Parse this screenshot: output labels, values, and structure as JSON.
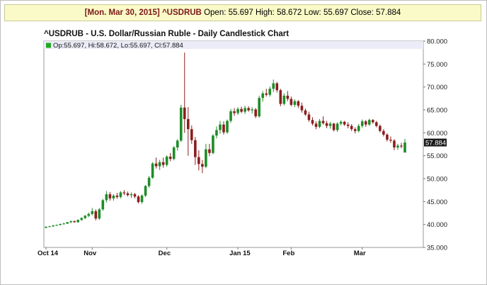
{
  "header": {
    "date": "[Mon. Mar 30, 2015]",
    "symbol": "^USDRUB",
    "open_label": "Open:",
    "open": "55.697",
    "high_label": "High:",
    "high": "58.672",
    "low_label": "Low:",
    "low": "55.697",
    "close_label": "Close:",
    "close": "57.884"
  },
  "colors": {
    "up": "#1e8c28",
    "down": "#8b1e1e",
    "legend_up": "#22aa22",
    "legend_bg": "#ececf8",
    "last_bg": "#1a1a1a"
  },
  "chart_data": {
    "type": "candlestick",
    "title": "^USDRUB - U.S. Dollar/Russian Ruble - Daily Candlestick Chart",
    "legend": "Op:55.697, Hi:58.672, Lo:55.697, Cl:57.884",
    "legend_placement": "top-left",
    "last_value_label": "57.884",
    "ylim": [
      35,
      80
    ],
    "y_ticks": [
      "80.000",
      "75.000",
      "70.000",
      "65.000",
      "60.000",
      "55.000",
      "50.000",
      "45.000",
      "40.000",
      "35.000"
    ],
    "x_labels": [
      {
        "label": "Oct 14",
        "index": 0
      },
      {
        "label": "Nov",
        "index": 13
      },
      {
        "label": "Dec",
        "index": 34
      },
      {
        "label": "Jan 15",
        "index": 54
      },
      {
        "label": "Feb",
        "index": 69
      },
      {
        "label": "Mar",
        "index": 89
      }
    ],
    "grid": false,
    "candles": [
      [
        39.3,
        39.6,
        39.2,
        39.5
      ],
      [
        39.5,
        39.7,
        39.4,
        39.6
      ],
      [
        39.6,
        39.9,
        39.5,
        39.8
      ],
      [
        39.8,
        40.0,
        39.7,
        39.9
      ],
      [
        39.9,
        40.2,
        39.8,
        40.1
      ],
      [
        40.1,
        40.4,
        40.0,
        40.2
      ],
      [
        40.2,
        40.6,
        40.1,
        40.5
      ],
      [
        40.5,
        40.9,
        40.3,
        40.7
      ],
      [
        40.7,
        40.9,
        40.4,
        40.5
      ],
      [
        40.5,
        41.1,
        40.4,
        41.0
      ],
      [
        41.0,
        41.6,
        40.8,
        41.4
      ],
      [
        41.4,
        42.1,
        41.2,
        41.9
      ],
      [
        41.9,
        42.6,
        41.6,
        42.3
      ],
      [
        42.3,
        43.6,
        42.0,
        42.9
      ],
      [
        42.9,
        43.3,
        40.9,
        41.3
      ],
      [
        41.3,
        43.6,
        41.0,
        43.3
      ],
      [
        43.3,
        45.6,
        43.0,
        45.3
      ],
      [
        45.3,
        47.3,
        44.8,
        46.6
      ],
      [
        46.6,
        47.1,
        45.2,
        45.7
      ],
      [
        45.7,
        46.6,
        45.2,
        46.3
      ],
      [
        46.3,
        46.9,
        45.6,
        46.0
      ],
      [
        46.0,
        47.3,
        45.7,
        47.0
      ],
      [
        47.0,
        47.5,
        46.4,
        46.8
      ],
      [
        46.8,
        47.2,
        46.1,
        46.4
      ],
      [
        46.4,
        47.0,
        45.8,
        46.6
      ],
      [
        46.6,
        46.9,
        45.7,
        46.1
      ],
      [
        46.1,
        46.4,
        44.6,
        44.9
      ],
      [
        44.9,
        46.6,
        44.5,
        46.3
      ],
      [
        46.3,
        48.6,
        46.0,
        48.4
      ],
      [
        48.4,
        50.6,
        48.0,
        50.2
      ],
      [
        50.2,
        53.6,
        50.0,
        53.3
      ],
      [
        53.3,
        54.6,
        52.2,
        52.7
      ],
      [
        52.7,
        54.1,
        51.9,
        53.6
      ],
      [
        53.6,
        54.6,
        52.4,
        53.0
      ],
      [
        53.0,
        55.1,
        52.6,
        54.8
      ],
      [
        54.8,
        55.6,
        53.8,
        54.3
      ],
      [
        54.3,
        57.1,
        54.0,
        56.8
      ],
      [
        56.8,
        58.6,
        56.1,
        58.3
      ],
      [
        58.3,
        66.1,
        58.0,
        65.5
      ],
      [
        65.5,
        77.5,
        60.0,
        63.0
      ],
      [
        63.0,
        65.6,
        55.0,
        60.8
      ],
      [
        60.8,
        61.6,
        57.6,
        58.4
      ],
      [
        58.4,
        59.1,
        53.0,
        54.7
      ],
      [
        54.7,
        56.2,
        51.8,
        53.2
      ],
      [
        53.2,
        54.1,
        51.2,
        52.6
      ],
      [
        52.6,
        57.6,
        52.3,
        56.4
      ],
      [
        56.4,
        57.6,
        54.9,
        55.6
      ],
      [
        55.6,
        59.7,
        55.3,
        59.4
      ],
      [
        59.4,
        61.4,
        58.8,
        60.6
      ],
      [
        60.6,
        62.6,
        59.8,
        61.8
      ],
      [
        61.8,
        62.5,
        59.6,
        60.1
      ],
      [
        60.1,
        62.9,
        59.8,
        62.6
      ],
      [
        62.6,
        65.2,
        62.2,
        64.7
      ],
      [
        64.7,
        65.4,
        63.7,
        64.3
      ],
      [
        64.3,
        65.6,
        63.9,
        65.2
      ],
      [
        65.2,
        65.7,
        64.3,
        64.6
      ],
      [
        64.6,
        65.9,
        64.1,
        65.4
      ],
      [
        65.4,
        65.8,
        64.6,
        64.9
      ],
      [
        64.9,
        65.6,
        64.2,
        65.1
      ],
      [
        65.1,
        65.4,
        63.2,
        63.6
      ],
      [
        63.6,
        68.1,
        63.3,
        67.6
      ],
      [
        67.6,
        69.1,
        66.8,
        68.6
      ],
      [
        68.6,
        69.6,
        67.9,
        68.3
      ],
      [
        68.3,
        70.1,
        67.9,
        69.6
      ],
      [
        69.6,
        71.6,
        68.9,
        70.8
      ],
      [
        70.8,
        71.1,
        68.8,
        69.3
      ],
      [
        69.3,
        69.6,
        65.8,
        66.3
      ],
      [
        66.3,
        68.6,
        66.0,
        68.1
      ],
      [
        68.1,
        69.1,
        66.9,
        67.4
      ],
      [
        67.4,
        67.9,
        65.8,
        66.1
      ],
      [
        66.1,
        67.3,
        65.6,
        66.9
      ],
      [
        66.9,
        67.1,
        65.4,
        65.9
      ],
      [
        65.9,
        66.6,
        64.4,
        64.9
      ],
      [
        64.9,
        65.3,
        63.7,
        64.0
      ],
      [
        64.0,
        64.6,
        62.4,
        62.8
      ],
      [
        62.8,
        63.4,
        61.6,
        62.0
      ],
      [
        62.0,
        62.5,
        60.8,
        61.3
      ],
      [
        61.3,
        63.0,
        61.0,
        62.6
      ],
      [
        62.6,
        63.6,
        61.8,
        62.1
      ],
      [
        62.1,
        62.6,
        61.0,
        61.5
      ],
      [
        61.5,
        62.4,
        60.9,
        62.0
      ],
      [
        62.0,
        62.2,
        60.3,
        60.6
      ],
      [
        60.6,
        62.3,
        60.2,
        62.0
      ],
      [
        62.0,
        62.7,
        61.6,
        62.4
      ],
      [
        62.4,
        62.6,
        61.5,
        61.8
      ],
      [
        61.8,
        62.3,
        61.0,
        61.5
      ],
      [
        61.5,
        61.9,
        60.4,
        60.8
      ],
      [
        60.8,
        61.2,
        59.9,
        60.4
      ],
      [
        60.4,
        61.9,
        60.1,
        61.5
      ],
      [
        61.5,
        62.9,
        61.1,
        62.5
      ],
      [
        62.5,
        62.8,
        61.3,
        61.8
      ],
      [
        61.8,
        63.1,
        61.5,
        62.8
      ],
      [
        62.8,
        63.0,
        62.0,
        62.3
      ],
      [
        62.3,
        62.6,
        61.2,
        61.5
      ],
      [
        61.5,
        61.8,
        60.1,
        60.4
      ],
      [
        60.4,
        60.8,
        59.2,
        59.6
      ],
      [
        59.6,
        59.9,
        58.1,
        58.5
      ],
      [
        58.5,
        59.2,
        57.8,
        58.3
      ],
      [
        58.3,
        58.6,
        56.2,
        56.8
      ],
      [
        56.8,
        57.6,
        56.3,
        57.2
      ],
      [
        57.2,
        57.8,
        56.6,
        57.0
      ],
      [
        55.697,
        58.672,
        55.697,
        57.884
      ]
    ]
  }
}
